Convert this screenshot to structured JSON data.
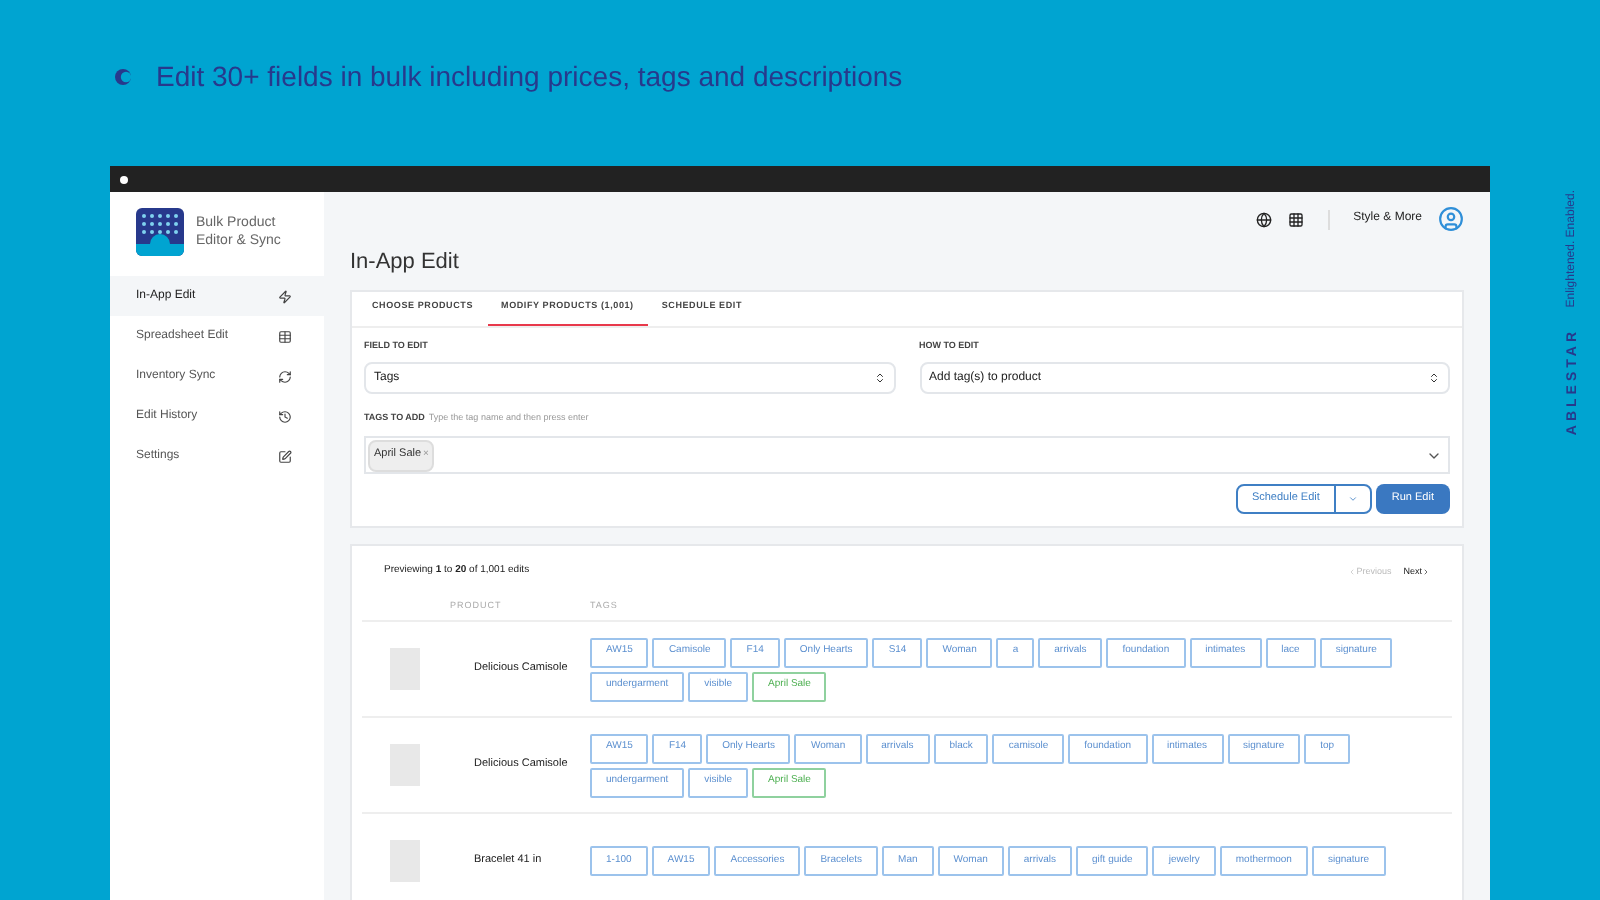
{
  "banner": {
    "headline": "Edit 30+ fields in bulk including prices, tags and descriptions"
  },
  "brand": {
    "name": "ABLESTAR",
    "tagline": "Enlightened. Enabled."
  },
  "app": {
    "name_line1": "Bulk Product",
    "name_line2": "Editor & Sync"
  },
  "sidebar": {
    "items": [
      {
        "label": "In-App Edit",
        "selected": true
      },
      {
        "label": "Spreadsheet Edit",
        "selected": false
      },
      {
        "label": "Inventory Sync",
        "selected": false
      },
      {
        "label": "Edit History",
        "selected": false
      },
      {
        "label": "Settings",
        "selected": false
      }
    ]
  },
  "header": {
    "store": "Style & More"
  },
  "page_title": "In-App Edit",
  "tabs": [
    {
      "label": "CHOOSE PRODUCTS",
      "selected": false
    },
    {
      "label": "MODIFY PRODUCTS (1,001)",
      "selected": true
    },
    {
      "label": "SCHEDULE EDIT",
      "selected": false
    }
  ],
  "form": {
    "field_label": "FIELD TO EDIT",
    "field_value": "Tags",
    "how_label": "HOW TO EDIT",
    "how_value": "Add tag(s) to product",
    "tags_label": "TAGS TO ADD",
    "tags_hint": "Type the tag name and then press enter",
    "tags": [
      "April Sale"
    ],
    "tag_remove": "×",
    "schedule_button": "Schedule Edit",
    "run_button": "Run Edit"
  },
  "preview": {
    "summary": "Previewing **1** to **20** of 1,001 edits",
    "previous": "Previous",
    "next": "Next",
    "columns": [
      "PRODUCT",
      "TAGS"
    ],
    "rows": [
      {
        "product": "Delicious Camisole",
        "tags": [
          {
            "label": "AW15",
            "added": false
          },
          {
            "label": "Camisole",
            "added": false
          },
          {
            "label": "F14",
            "added": false
          },
          {
            "label": "Only Hearts",
            "added": false
          },
          {
            "label": "S14",
            "added": false
          },
          {
            "label": "Woman",
            "added": false
          },
          {
            "label": "a",
            "added": false
          },
          {
            "label": "arrivals",
            "added": false
          },
          {
            "label": "foundation",
            "added": false
          },
          {
            "label": "intimates",
            "added": false
          },
          {
            "label": "lace",
            "added": false
          },
          {
            "label": "signature",
            "added": false
          },
          {
            "label": "undergarment",
            "added": false
          },
          {
            "label": "visible",
            "added": false
          },
          {
            "label": "April Sale",
            "added": true
          }
        ]
      },
      {
        "product": "Delicious Camisole",
        "tags": [
          {
            "label": "AW15",
            "added": false
          },
          {
            "label": "F14",
            "added": false
          },
          {
            "label": "Only Hearts",
            "added": false
          },
          {
            "label": "Woman",
            "added": false
          },
          {
            "label": "arrivals",
            "added": false
          },
          {
            "label": "black",
            "added": false
          },
          {
            "label": "camisole",
            "added": false
          },
          {
            "label": "foundation",
            "added": false
          },
          {
            "label": "intimates",
            "added": false
          },
          {
            "label": "signature",
            "added": false
          },
          {
            "label": "top",
            "added": false
          },
          {
            "label": "undergarment",
            "added": false
          },
          {
            "label": "visible",
            "added": false
          },
          {
            "label": "April Sale",
            "added": true
          }
        ]
      },
      {
        "product": "Bracelet 41 in",
        "tags": [
          {
            "label": "1-100",
            "added": false
          },
          {
            "label": "AW15",
            "added": false
          },
          {
            "label": "Accessories",
            "added": false
          },
          {
            "label": "Bracelets",
            "added": false
          },
          {
            "label": "Man",
            "added": false
          },
          {
            "label": "Woman",
            "added": false
          },
          {
            "label": "arrivals",
            "added": false
          },
          {
            "label": "gift guide",
            "added": false
          },
          {
            "label": "jewelry",
            "added": false
          },
          {
            "label": "mothermoon",
            "added": false
          },
          {
            "label": "signature",
            "added": false
          }
        ]
      }
    ]
  }
}
